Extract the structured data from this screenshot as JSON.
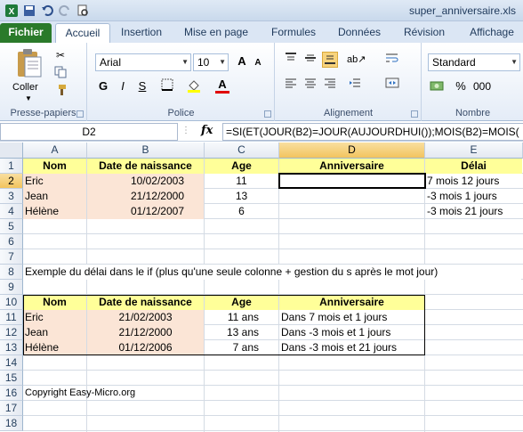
{
  "window": {
    "title": "super_anniversaire.xls"
  },
  "tabs": [
    "Fichier",
    "Accueil",
    "Insertion",
    "Mise en page",
    "Formules",
    "Données",
    "Révision",
    "Affichage"
  ],
  "ribbon": {
    "groups": {
      "clipboard": "Presse-papiers",
      "font": "Police",
      "alignment": "Alignement",
      "number": "Nombre"
    },
    "paste_label": "Coller",
    "font_name": "Arial",
    "font_size": "10",
    "number_format": "Standard",
    "bold": "G",
    "italic": "I",
    "underline": "S",
    "font_color_letter": "A",
    "percent": "%",
    "thousands": "000"
  },
  "formula_bar": {
    "name_box": "D2",
    "fx": "fx",
    "formula": "=SI(ET(JOUR(B2)=JOUR(AUJOURDHUI());MOIS(B2)=MOIS("
  },
  "columns": [
    "A",
    "B",
    "C",
    "D",
    "E"
  ],
  "rows": [
    "1",
    "2",
    "3",
    "4",
    "5",
    "6",
    "7",
    "8",
    "9",
    "10",
    "11",
    "12",
    "13",
    "14",
    "15",
    "16",
    "17",
    "18"
  ],
  "table1": {
    "headers": [
      "Nom",
      "Date de naissance",
      "Age",
      "Anniversaire",
      "Délai"
    ],
    "rows": [
      [
        "Eric",
        "10/02/2003",
        "11",
        "",
        "7 mois 12 jours"
      ],
      [
        "Jean",
        "21/12/2000",
        "13",
        "",
        "-3 mois 1 jours"
      ],
      [
        "Hélène",
        "01/12/2007",
        "6",
        "",
        "-3 mois 21 jours"
      ]
    ]
  },
  "note": "Exemple du délai dans le if (plus qu'une seule colonne + gestion du s après le mot jour)",
  "table2": {
    "headers": [
      "Nom",
      "Date de naissance",
      "Age",
      "Anniversaire"
    ],
    "rows": [
      [
        "Eric",
        "21/02/2003",
        "11 ans",
        "Dans 7 mois et 1 jours"
      ],
      [
        "Jean",
        "21/12/2000",
        "13 ans",
        "Dans -3 mois et 1 jours"
      ],
      [
        "Hélène",
        "01/12/2006",
        "7 ans",
        "Dans -3 mois et 21 jours"
      ]
    ]
  },
  "copyright": "Copyright Easy-Micro.org",
  "colors": {
    "header_fill": "#ffff99",
    "name_fill": "#fbe5d6",
    "file_tab": "#2a7a2a"
  }
}
